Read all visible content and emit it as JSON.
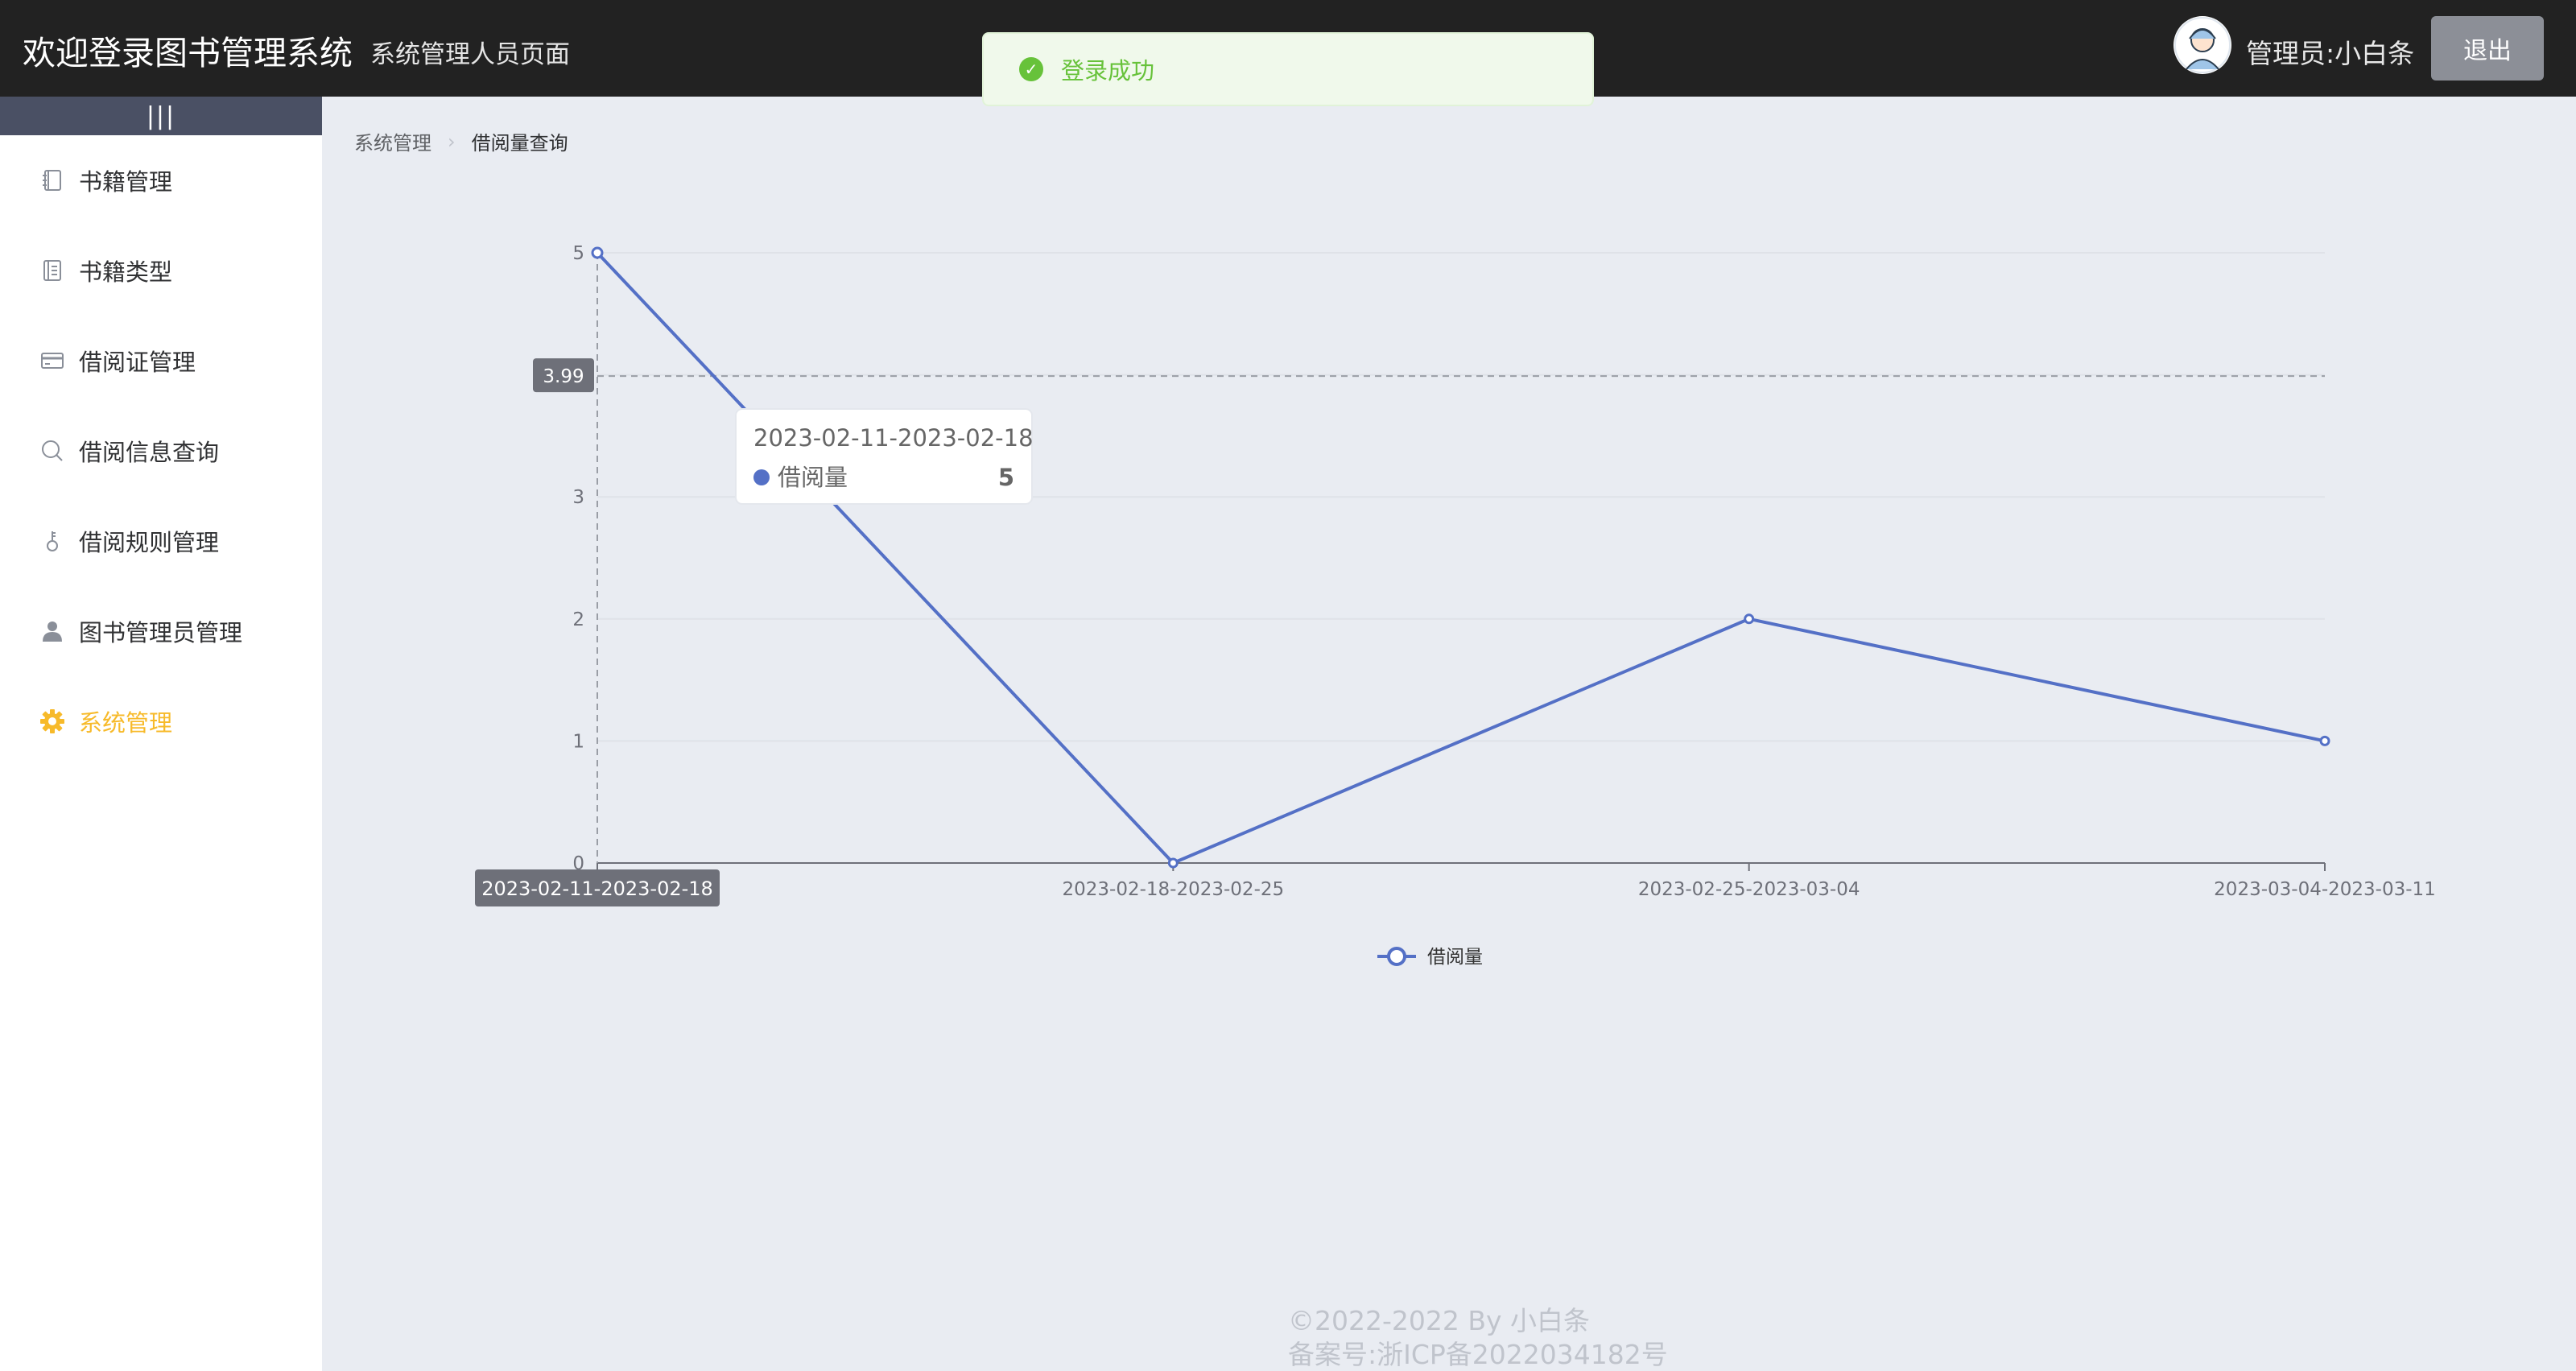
{
  "header": {
    "title": "欢迎登录图书管理系统",
    "subtitle": "系统管理人员页面",
    "admin_label": "管理员:小白条",
    "logout_label": "退出"
  },
  "toast": {
    "message": "登录成功",
    "color": "#67c23a"
  },
  "sidebar": {
    "collapse_label": "|||",
    "items": [
      {
        "label": "书籍管理",
        "icon": "notebook-icon"
      },
      {
        "label": "书籍类型",
        "icon": "document-icon"
      },
      {
        "label": "借阅证管理",
        "icon": "card-icon"
      },
      {
        "label": "借阅信息查询",
        "icon": "search-icon"
      },
      {
        "label": "借阅规则管理",
        "icon": "key-icon"
      },
      {
        "label": "图书管理员管理",
        "icon": "user-icon"
      },
      {
        "label": "系统管理",
        "icon": "gear-icon",
        "active": true
      }
    ],
    "active_color": "#f7ba2a"
  },
  "breadcrumb": {
    "parent": "系统管理",
    "current": "借阅量查询"
  },
  "chart_data": {
    "type": "line",
    "categories": [
      "2023-02-11-2023-02-18",
      "2023-02-18-2023-02-25",
      "2023-02-25-2023-03-04",
      "2023-03-04-2023-03-11"
    ],
    "series": [
      {
        "name": "借阅量",
        "values": [
          5,
          0,
          2,
          1
        ],
        "color": "#5470c6"
      }
    ],
    "ylim": [
      0,
      5
    ],
    "yticks": [
      0,
      1,
      2,
      3,
      4,
      5
    ],
    "legend": "bottom-center",
    "crosshair": {
      "y_value": "3.99",
      "category": "2023-02-11-2023-02-18"
    },
    "tooltip": {
      "title": "2023-02-11-2023-02-18",
      "series": "借阅量",
      "value": "5"
    }
  },
  "footer": {
    "copyright": "©2022-2022 By 小白条",
    "icp": "备案号:浙ICP备2022034182号"
  }
}
